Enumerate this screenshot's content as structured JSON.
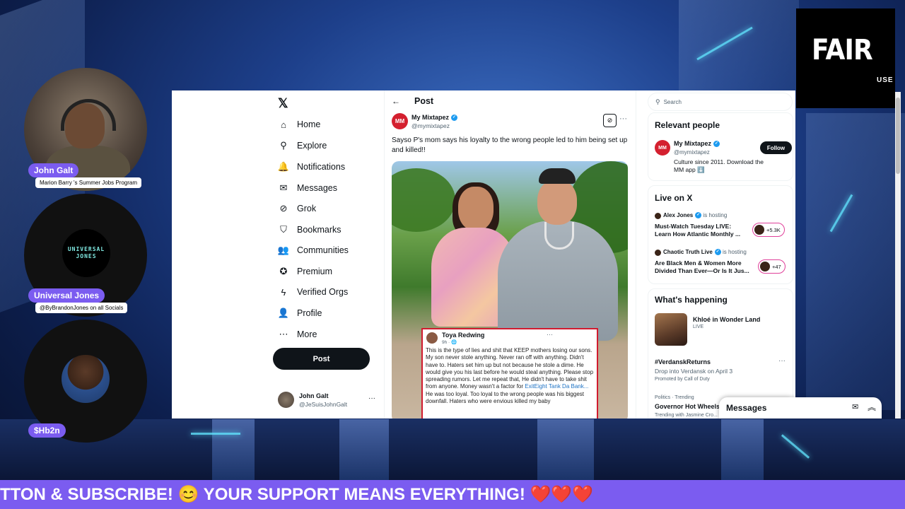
{
  "overlay": {
    "fair_use_big": "FAIR",
    "fair_use_small": "USE",
    "ticker_text": "TTON & SUBSCRIBE! 😊 YOUR SUPPORT MEANS EVERYTHING! ❤️❤️❤️"
  },
  "participants": [
    {
      "name": "John Galt",
      "subtitle": "Marion Barry 's Summer Jobs Program"
    },
    {
      "name": "Universal Jones",
      "subtitle": "@ByBrandonJones on all Socials",
      "logo_line1": "UNIVERSAL",
      "logo_line2": "JONES"
    },
    {
      "name": "$Hb2n"
    }
  ],
  "nav": {
    "logo": "𝕏",
    "items": [
      {
        "label": "Home",
        "icon": "⌂"
      },
      {
        "label": "Explore",
        "icon": "⚲"
      },
      {
        "label": "Notifications",
        "icon": "🔔"
      },
      {
        "label": "Messages",
        "icon": "✉"
      },
      {
        "label": "Grok",
        "icon": "⊘"
      },
      {
        "label": "Bookmarks",
        "icon": "⛉"
      },
      {
        "label": "Communities",
        "icon": "👥"
      },
      {
        "label": "Premium",
        "icon": "✪"
      },
      {
        "label": "Verified Orgs",
        "icon": "ϟ"
      },
      {
        "label": "Profile",
        "icon": "👤"
      },
      {
        "label": "More",
        "icon": "⋯"
      }
    ],
    "post_button": "Post",
    "account": {
      "name": "John Galt",
      "handle": "@JeSuisJohnGalt",
      "more": "···"
    }
  },
  "post": {
    "back": "←",
    "header": "Post",
    "author_name": "My Mixtapez",
    "author_handle": "@mymixtapez",
    "avatar_text": "MM",
    "more": "···",
    "text": "Sayso P's mom says his loyalty to the wrong people led to him being set up and killed!!",
    "quote": {
      "name": "Toya Redwing",
      "time": "9h · 🌐",
      "more": "···",
      "body_before_link": "This is the type of lies and shit that KEEP mothers losing our sons. My son never stole anything. Never ran off with anything. Didn't have to. Haters set him up but not because he stole a dime. He would give you his last before he would steal anything. Please stop spreading rumors. Let me repeat that, He didn't have to take shit from anyone. Money wasn't a factor for ",
      "link": "ExitEight Tank Da Bank...",
      "body_after_link": " He was too loyal. Too loyal to the wrong people was his biggest downfall. Haters who were envious killed my baby"
    }
  },
  "sidebar": {
    "search_placeholder": "Search",
    "relevant": {
      "title": "Relevant people",
      "name": "My Mixtapez",
      "handle": "@mymixtapez",
      "avatar_text": "MM",
      "bio": "Culture since 2011. Download the MM app ⬇️",
      "follow": "Follow"
    },
    "live": {
      "title": "Live on X",
      "items": [
        {
          "host": "Alex Jones",
          "status": "is hosting",
          "title": "Must-Watch Tuesday LIVE: Learn How Atlantic Monthly ...",
          "count": "+5.3K"
        },
        {
          "host": "Chaotic Truth Live",
          "status": "is hosting",
          "title": "Are Black Men & Women More Divided Than Ever—Or Is It Jus...",
          "count": "+47"
        }
      ]
    },
    "happening": {
      "title": "What's happening",
      "featured": {
        "title": "Khloé in Wonder Land",
        "status": "LIVE"
      },
      "promo": {
        "tag": "#VerdanskReturns",
        "desc": "Drop into Verdansk on April 3",
        "promoted": "Promoted by Call of Duty",
        "more": "···"
      },
      "trend": {
        "category": "Politics · Trending",
        "title": "Governor Hot Wheels",
        "sub": "Trending with Jasmine Cro..."
      }
    },
    "messages_bar": "Messages"
  }
}
